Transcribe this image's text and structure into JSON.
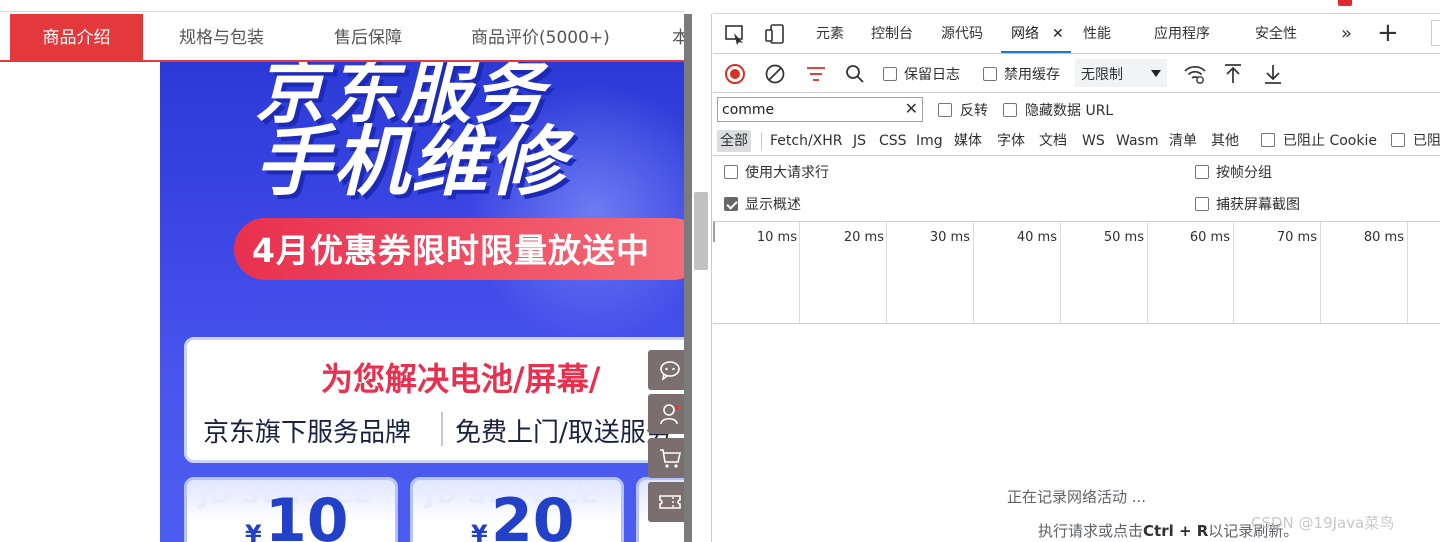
{
  "page": {
    "tabs": [
      {
        "label": "商品介绍"
      },
      {
        "label": "规格与包装"
      },
      {
        "label": "售后保障"
      },
      {
        "label": "商品评价(5000+)"
      },
      {
        "label": "本"
      }
    ],
    "banner": {
      "headline_1": "京东服务",
      "headline_2": "手机维修",
      "coupon_pill": "4月优惠券限时限量放送中",
      "card_title": "为您解决电池/屏幕/",
      "card_sub_left": "京东旗下服务品牌",
      "card_sub_right": "免费上门/取送服务",
      "voucher_ghost": "JD SERVICE",
      "voucher_yen": "¥",
      "voucher_1": "10",
      "voucher_2": "20"
    },
    "float_bar": [
      "chat-icon",
      "user-icon",
      "cart-icon",
      "ticket-icon"
    ]
  },
  "devtools": {
    "tabs": [
      "元素",
      "控制台",
      "源代码",
      "网络",
      "性能",
      "应用程序",
      "安全性"
    ],
    "active_tab": "网络",
    "more_tabs": "»",
    "add_tab": "+",
    "toolbar": {
      "preserve_log": "保留日志",
      "disable_cache": "禁用缓存",
      "throttling": "无限制"
    },
    "filter": {
      "value": "comme",
      "invert": "反转",
      "hide_data_urls": "隐藏数据 URL"
    },
    "types": [
      "全部",
      "Fetch/XHR",
      "JS",
      "CSS",
      "Img",
      "媒体",
      "字体",
      "文档",
      "WS",
      "Wasm",
      "清单",
      "其他"
    ],
    "blocked_cookies": "已阻止 Cookie",
    "blocked_requests": "已阻",
    "settings": {
      "big_rows": "使用大请求行",
      "show_overview": "显示概述",
      "group_by_frame": "按帧分组",
      "capture_screenshots": "捕获屏幕截图"
    },
    "timeline_ticks": [
      "10 ms",
      "20 ms",
      "30 ms",
      "40 ms",
      "50 ms",
      "60 ms",
      "70 ms",
      "80 ms"
    ],
    "empty_title": "正在记录网络活动 ...",
    "empty_hint_pre": "执行请求或点击",
    "empty_hint_key": "Ctrl + R",
    "empty_hint_post": "以记录刷新。",
    "watermark": "CSDN @19Java菜鸟"
  },
  "colors": {
    "jd_red": "#e4393c",
    "devtools_blue": "#1a73e8",
    "record_red": "#d93025"
  }
}
